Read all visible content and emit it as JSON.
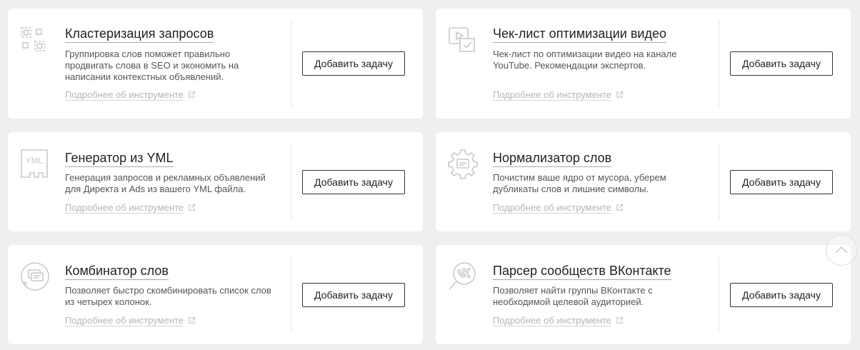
{
  "tools": [
    {
      "title": "Кластеризация запросов",
      "description": "Группировка слов поможет правильно продвигать слова в SEO и экономить на написании контекстных объявлений.",
      "more_link": "Подробнее об инструменте",
      "add_button": "Добавить задачу",
      "icon": "clustering-icon"
    },
    {
      "title": "Чек-лист оптимизации видео",
      "description": "Чек-лист по оптимизации видео на канале YouTube. Рекомендации экспертов.",
      "more_link": "Подробнее об инструменте",
      "add_button": "Добавить задачу",
      "icon": "video-checklist-icon"
    },
    {
      "title": "Генератор из YML",
      "description": "Генерация запросов и рекламных объявлений для Директа и Ads из вашего YML файла.",
      "more_link": "Подробнее об инструменте",
      "add_button": "Добавить задачу",
      "icon": "yml-file-icon",
      "icon_text": "YML"
    },
    {
      "title": "Нормализатор слов",
      "description": "Почистим ваше ядро от мусора, уберем дубликаты слов и лишние символы.",
      "more_link": "Подробнее об инструменте",
      "add_button": "Добавить задачу",
      "icon": "gear-icon"
    },
    {
      "title": "Комбинатор слов",
      "description": "Позволяет быстро скомбинировать список слов из четырех колонок.",
      "more_link": "Подробнее об инструменте",
      "add_button": "Добавить задачу",
      "icon": "combinator-icon"
    },
    {
      "title": "Парсер сообществ ВКонтакте",
      "description": "Позволяет найти группы ВКонтакте с необходимой целевой аудиторией.",
      "more_link": "Подробнее об инструменте",
      "add_button": "Добавить задачу",
      "icon": "vk-search-icon"
    }
  ],
  "scroll_top": {
    "icon": "chevron-up-icon"
  },
  "colors": {
    "page_background": "#efefef",
    "card_background": "#ffffff",
    "icon_gray": "#c9c9c9",
    "muted_link": "#b5b5b5"
  }
}
